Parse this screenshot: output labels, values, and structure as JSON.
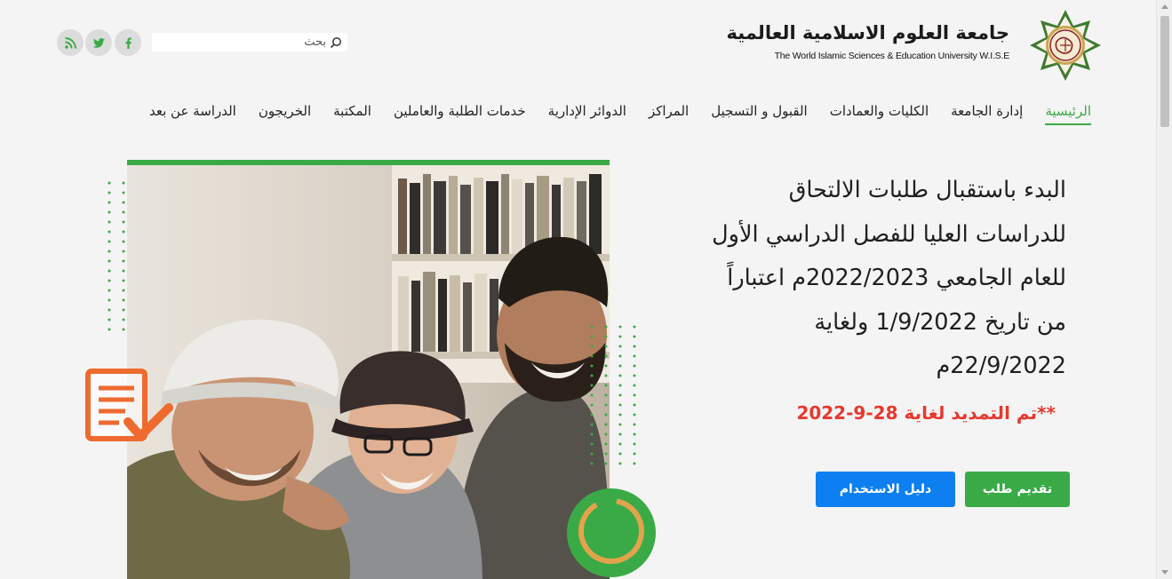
{
  "header": {
    "brand_ar": "جامعة العلوم الاسلامية العالمية",
    "brand_en": "The World Islamic Sciences & Education University W.I.S.E",
    "search_placeholder": "بحث",
    "social": [
      "facebook-icon",
      "twitter-icon",
      "rss-icon"
    ]
  },
  "nav": {
    "items": [
      {
        "label": "الرئيسية"
      },
      {
        "label": "إدارة الجامعة"
      },
      {
        "label": "الكليات والعمادات"
      },
      {
        "label": "القبول و التسجيل"
      },
      {
        "label": "المراكز"
      },
      {
        "label": "الدوائر الإدارية"
      },
      {
        "label": "خدمات الطلبة والعاملين"
      },
      {
        "label": "المكتبة"
      },
      {
        "label": "الخريجون"
      },
      {
        "label": "الدراسة عن بعد"
      }
    ]
  },
  "hero": {
    "lines": [
      "البدء باستقبال طلبات الالتحاق",
      "للدراسات العليا للفصل الدراسي الأول",
      "للعام الجامعي 2022/2023م اعتباراً",
      "من تاريخ 1/9/2022 ولغاية",
      "22/9/2022م"
    ],
    "extension": "**تم التمديد لغاية 28-9-2022",
    "apply_label": "تقديم طلب",
    "guide_label": "دليل الاستخدام"
  },
  "colors": {
    "accent_green": "#3aaa46",
    "accent_blue": "#0d7ff0",
    "alert_red": "#e8382e",
    "orange": "#ee6a2f"
  }
}
